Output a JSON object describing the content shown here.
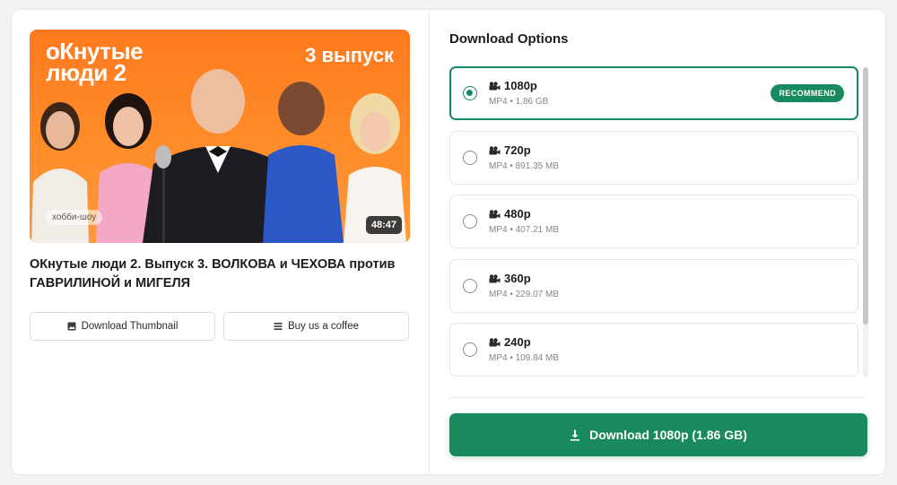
{
  "colors": {
    "accent": "#188a5d",
    "thumbnail_bg": "#ff8c2a"
  },
  "video": {
    "thumbnail": {
      "title_line1": "оКнутые",
      "title_line2": "люди 2",
      "episode": "3 выпуск",
      "tag": "хобби-шоу",
      "duration": "48:47"
    },
    "title": "ОКнутые люди 2. Выпуск 3. ВОЛКОВА и ЧЕХОВА против ГАВРИЛИНОЙ и МИГЕЛЯ",
    "buttons": {
      "download_thumbnail": "Download Thumbnail",
      "buy_coffee": "Buy us a coffee"
    }
  },
  "download_options": {
    "heading": "Download Options",
    "items": [
      {
        "resolution": "1080p",
        "meta": "MP4 • 1.86 GB",
        "selected": true,
        "badge": "RECOMMEND"
      },
      {
        "resolution": "720p",
        "meta": "MP4 • 891.35 MB",
        "selected": false
      },
      {
        "resolution": "480p",
        "meta": "MP4 • 407.21 MB",
        "selected": false
      },
      {
        "resolution": "360p",
        "meta": "MP4 • 229.07 MB",
        "selected": false
      },
      {
        "resolution": "240p",
        "meta": "MP4 • 109.84 MB",
        "selected": false
      }
    ],
    "download_button": "Download 1080p (1.86 GB)"
  }
}
